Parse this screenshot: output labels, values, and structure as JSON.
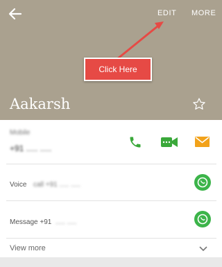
{
  "header": {
    "edit_label": "EDIT",
    "more_label": "MORE",
    "contact_name": "Aakarsh",
    "background_color": "#aaa18f"
  },
  "annotation": {
    "label": "Click Here",
    "color": "#e64a45"
  },
  "mobile": {
    "type_label": "Mobile",
    "number": "+91 ..... ....."
  },
  "voice": {
    "label": "Voice",
    "number": "call +91 ..... ....."
  },
  "message": {
    "label": "Message +91",
    "number": "..... ....."
  },
  "view_more_label": "View more",
  "colors": {
    "call_green": "#3aa83a",
    "video_green": "#3aa83a",
    "email_orange": "#f2a21a",
    "whatsapp_green": "#3cb44a"
  }
}
